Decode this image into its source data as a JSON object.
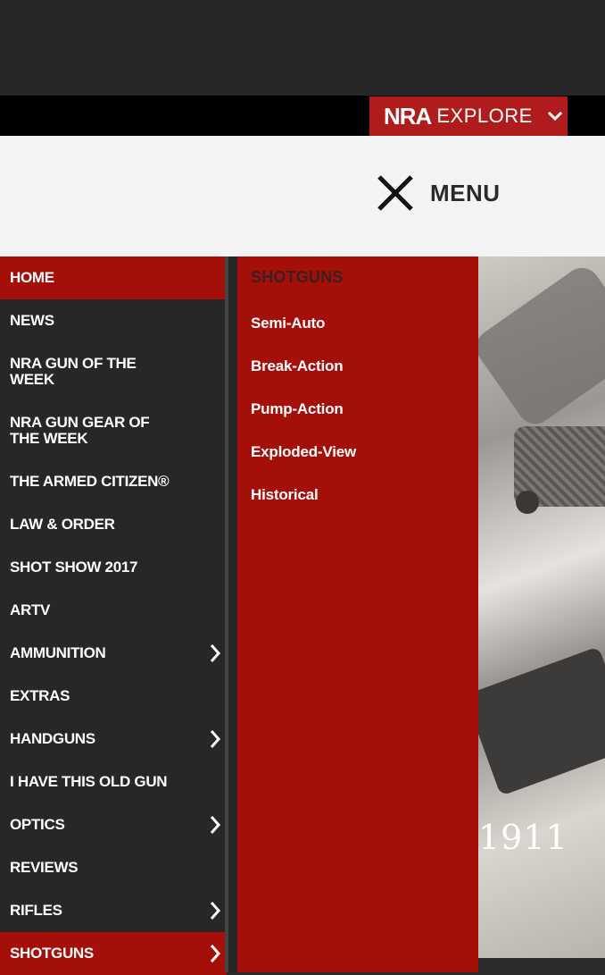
{
  "explore": {
    "brand": "NRA",
    "label": "EXPLORE"
  },
  "header": {
    "menu_label": "MENU"
  },
  "nav": {
    "items": [
      {
        "label": "HOME",
        "active": true,
        "has_sub": false
      },
      {
        "label": "NEWS",
        "has_sub": false
      },
      {
        "label": "NRA GUN OF THE WEEK",
        "has_sub": false
      },
      {
        "label": "NRA GUN GEAR OF THE WEEK",
        "has_sub": false
      },
      {
        "label": "THE ARMED CITIZEN®",
        "has_sub": false
      },
      {
        "label": "LAW & ORDER",
        "has_sub": false
      },
      {
        "label": "SHOT SHOW 2017",
        "has_sub": false
      },
      {
        "label": "ARTV",
        "has_sub": false
      },
      {
        "label": "AMMUNITION",
        "has_sub": true
      },
      {
        "label": "EXTRAS",
        "has_sub": false
      },
      {
        "label": "HANDGUNS",
        "has_sub": true
      },
      {
        "label": "I HAVE THIS OLD GUN",
        "has_sub": false
      },
      {
        "label": "OPTICS",
        "has_sub": true
      },
      {
        "label": "REVIEWS",
        "has_sub": false
      },
      {
        "label": "RIFLES",
        "has_sub": true
      },
      {
        "label": "SHOTGUNS",
        "active": true,
        "has_sub": true
      }
    ]
  },
  "submenu": {
    "title": "SHOTGUNS",
    "items": [
      "Semi-Auto",
      "Break-Action",
      "Pump-Action",
      "Exploded-View",
      "Historical"
    ]
  },
  "hero": {
    "caption": "1911"
  },
  "colors": {
    "accent": "#a50f0a",
    "nav_bg": "#272727",
    "header_bg": "#f4f4f4"
  }
}
